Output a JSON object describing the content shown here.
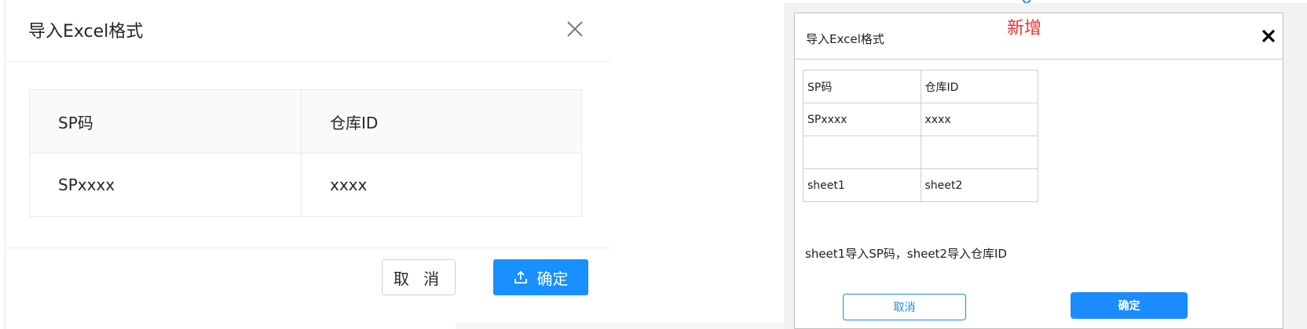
{
  "colors": {
    "primary": "#1890ff",
    "danger_text": "#f23030",
    "marker": "#1296db"
  },
  "left_dialog": {
    "title": "导入Excel格式",
    "close_icon": "close-icon",
    "table": {
      "headers": [
        "SP码",
        "仓库ID"
      ],
      "rows": [
        [
          "SPxxxx",
          "xxxx"
        ]
      ]
    },
    "cancel_label": "取 消",
    "confirm_icon": "upload-icon",
    "confirm_label": "确定"
  },
  "right_mockup": {
    "title": "导入Excel格式",
    "annotation": "新增",
    "close_icon": "close-icon",
    "table": {
      "rows": [
        [
          "SP码",
          "仓库ID"
        ],
        [
          "SPxxxx",
          "xxxx"
        ],
        [
          "",
          ""
        ],
        [
          "sheet1",
          "sheet2"
        ]
      ]
    },
    "note": "sheet1导入SP码，sheet2导入仓库ID",
    "cancel_label": "取消",
    "confirm_label": "确定"
  }
}
